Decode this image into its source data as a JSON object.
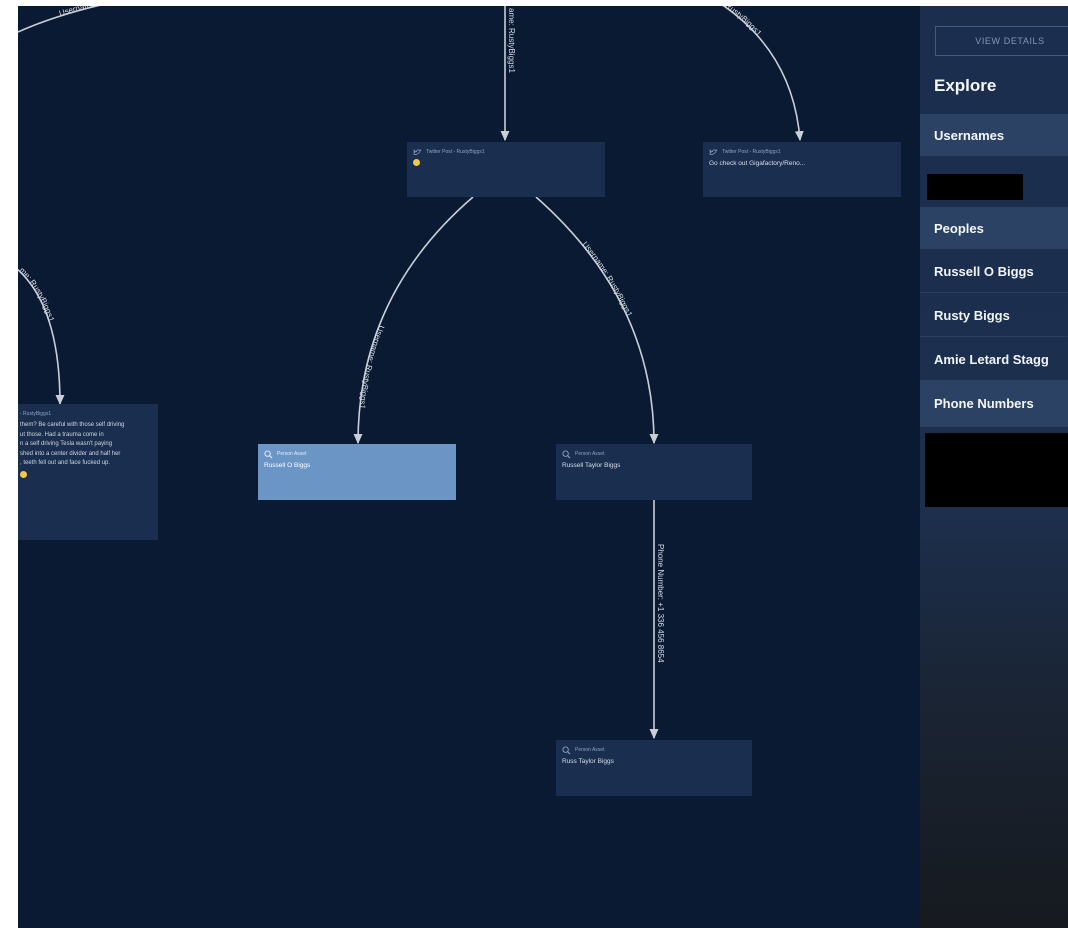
{
  "graph": {
    "edges": [
      {
        "id": "e-top-left",
        "label": "Username..."
      },
      {
        "id": "e-top-center",
        "label": "ame: RustyBiggs1"
      },
      {
        "id": "e-top-right",
        "label": "RustyBiggs1"
      },
      {
        "id": "e-left",
        "label": "me: RustyBiggs1"
      },
      {
        "id": "e-mid-left",
        "label": "Username: RustyBiggs1"
      },
      {
        "id": "e-mid-right",
        "label": "Username: RustyBiggs1"
      },
      {
        "id": "e-phone",
        "label": "Phone Number: +1 336 456 8654"
      }
    ],
    "nodes": {
      "twitter_post_1": {
        "type": "Twitter Post - RustyBiggs1"
      },
      "twitter_post_2": {
        "type": "Twitter Post - RustyBiggs1",
        "text": "Go check out Gigafactory/Reno..."
      },
      "twitter_post_left": {
        "type": "- RustyBiggs1",
        "text": "them? Be careful with those self driving\nut those. Had a trauma come in\nn a self driving Tesla wasn't paying\nshed into a center divider and half her\n, teeth fell out and face fucked up."
      },
      "person_russell_o": {
        "type": "Person Asset",
        "name": "Russell O Biggs"
      },
      "person_russell_taylor": {
        "type": "Person Asset",
        "name": "Russell Taylor Biggs"
      },
      "person_russ_taylor": {
        "type": "Person Asset",
        "name": "Russ Taylor Biggs"
      }
    }
  },
  "panel": {
    "view_details_label": "VIEW DETAILS",
    "title": "Explore",
    "sections": {
      "usernames": "Usernames",
      "peoples": "Peoples",
      "phone_numbers": "Phone Numbers"
    },
    "people": [
      "Russell O Biggs",
      "Rusty Biggs",
      "Amie Letard Stagg"
    ]
  },
  "colors": {
    "canvas_bg": "#0b1a33",
    "node_bg": "#1a2e50",
    "node_selected_bg": "#6b95c4",
    "panel_header_bg": "#2c4264",
    "emoji": "#f2c94c"
  },
  "icons": {
    "twitter_post": "twitter-icon",
    "person_asset": "magnifier-person-icon"
  }
}
